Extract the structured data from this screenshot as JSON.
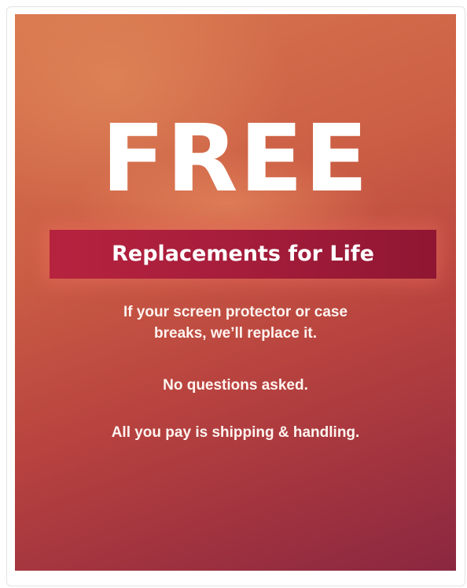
{
  "promo": {
    "headline": "FREE",
    "ribbon_text": "Replacements for Life",
    "body_line_1": "If your screen protector or case",
    "body_line_2": "breaks, we’ll replace it.",
    "body_line_3": "No questions asked.",
    "body_line_4": "All you pay is shipping & handling.",
    "colors": {
      "gradient_start": "#d8774f",
      "gradient_end": "#8a2740",
      "ribbon": "#a51d3b",
      "text": "#ffffff"
    }
  }
}
